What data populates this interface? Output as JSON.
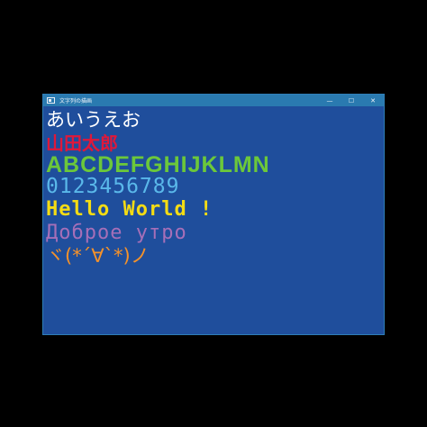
{
  "window": {
    "title": "文字列の描画",
    "controls": {
      "minimize": "—",
      "maximize": "☐",
      "close": "✕"
    }
  },
  "lines": [
    {
      "text": "あいうえお",
      "color": "#ffffff"
    },
    {
      "text": "山田太郎",
      "color": "#e0183a"
    },
    {
      "text": "ABCDEFGHIJKLMN",
      "color": "#6cc83a"
    },
    {
      "text": "0123456789",
      "color": "#5ab8ea"
    },
    {
      "text": "Hello World !",
      "color": "#f4dc14"
    },
    {
      "text": "Доброе утро",
      "color": "#a66fb8"
    },
    {
      "text": "ヾ(*´∀`*)ノ",
      "color": "#f5922a"
    }
  ],
  "colors": {
    "background": "#000000",
    "client_area": "#1f4e9c",
    "titlebar": "#2a7ab0"
  }
}
